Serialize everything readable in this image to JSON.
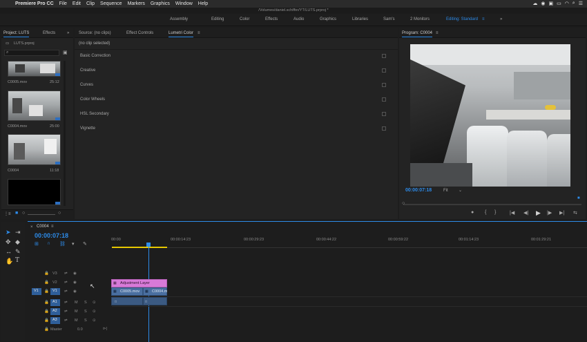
{
  "menubar": {
    "apple": "",
    "app_name": "Premiere Pro CC",
    "items": [
      "File",
      "Edit",
      "Clip",
      "Sequence",
      "Markers",
      "Graphics",
      "Window",
      "Help"
    ]
  },
  "title_path": "/Volumes/daniel.schiffer/YT/LUTS.prproj *",
  "workspaces": [
    "Assembly",
    "Editing",
    "Color",
    "Effects",
    "Audio",
    "Graphics",
    "Libraries",
    "Sam's",
    "2 Monitors",
    "Editing: Standard"
  ],
  "workspace_more": "»",
  "project_panel": {
    "tab_project": "Project: LUTS",
    "tab_effects": "Effects",
    "tab_more": "»",
    "bin_name": "LUTS.prproj",
    "clips": [
      {
        "name": "C0005.mov",
        "duration": "25:12"
      },
      {
        "name": "C0004.mov",
        "duration": "25:00"
      },
      {
        "name": "C0004",
        "duration": "11:18"
      }
    ]
  },
  "lumetri_panel": {
    "tab_source": "Source: (no clips)",
    "tab_effect_controls": "Effect Controls",
    "tab_lumetri": "Lumetri Color",
    "no_clip": "(no clip selected)",
    "sections": [
      "Basic Correction",
      "Creative",
      "Curves",
      "Color Wheels",
      "HSL Secondary",
      "Vignette"
    ]
  },
  "program_monitor": {
    "tab": "Program: C0004",
    "timecode": "00:00:07:18",
    "fit": "Fit"
  },
  "timeline": {
    "sequence_tab": "C0004",
    "timecode": "00:00:07:18",
    "ruler": [
      "00:00",
      "00:00:14:23",
      "00:00:29:23",
      "00:00:44:22",
      "00:00:59:22",
      "00:01:14:23",
      "00:01:29:21"
    ],
    "video_tracks": [
      "V3",
      "V2",
      "V1"
    ],
    "audio_tracks": [
      "A1",
      "A2",
      "A3"
    ],
    "source_patch": "V1",
    "master_label": "Master",
    "master_value": "0.0",
    "clips": {
      "adjustment": "Adjustment Layer",
      "v1_a": "C0005.mov",
      "v1_b": "C0004.m"
    }
  },
  "colors": {
    "accent": "#2d8ceb",
    "adjustment_clip": "#d77ad8",
    "video_clip": "#4a6fa0",
    "audio_clip": "#3b5a82",
    "work_area": "#e7c800"
  }
}
